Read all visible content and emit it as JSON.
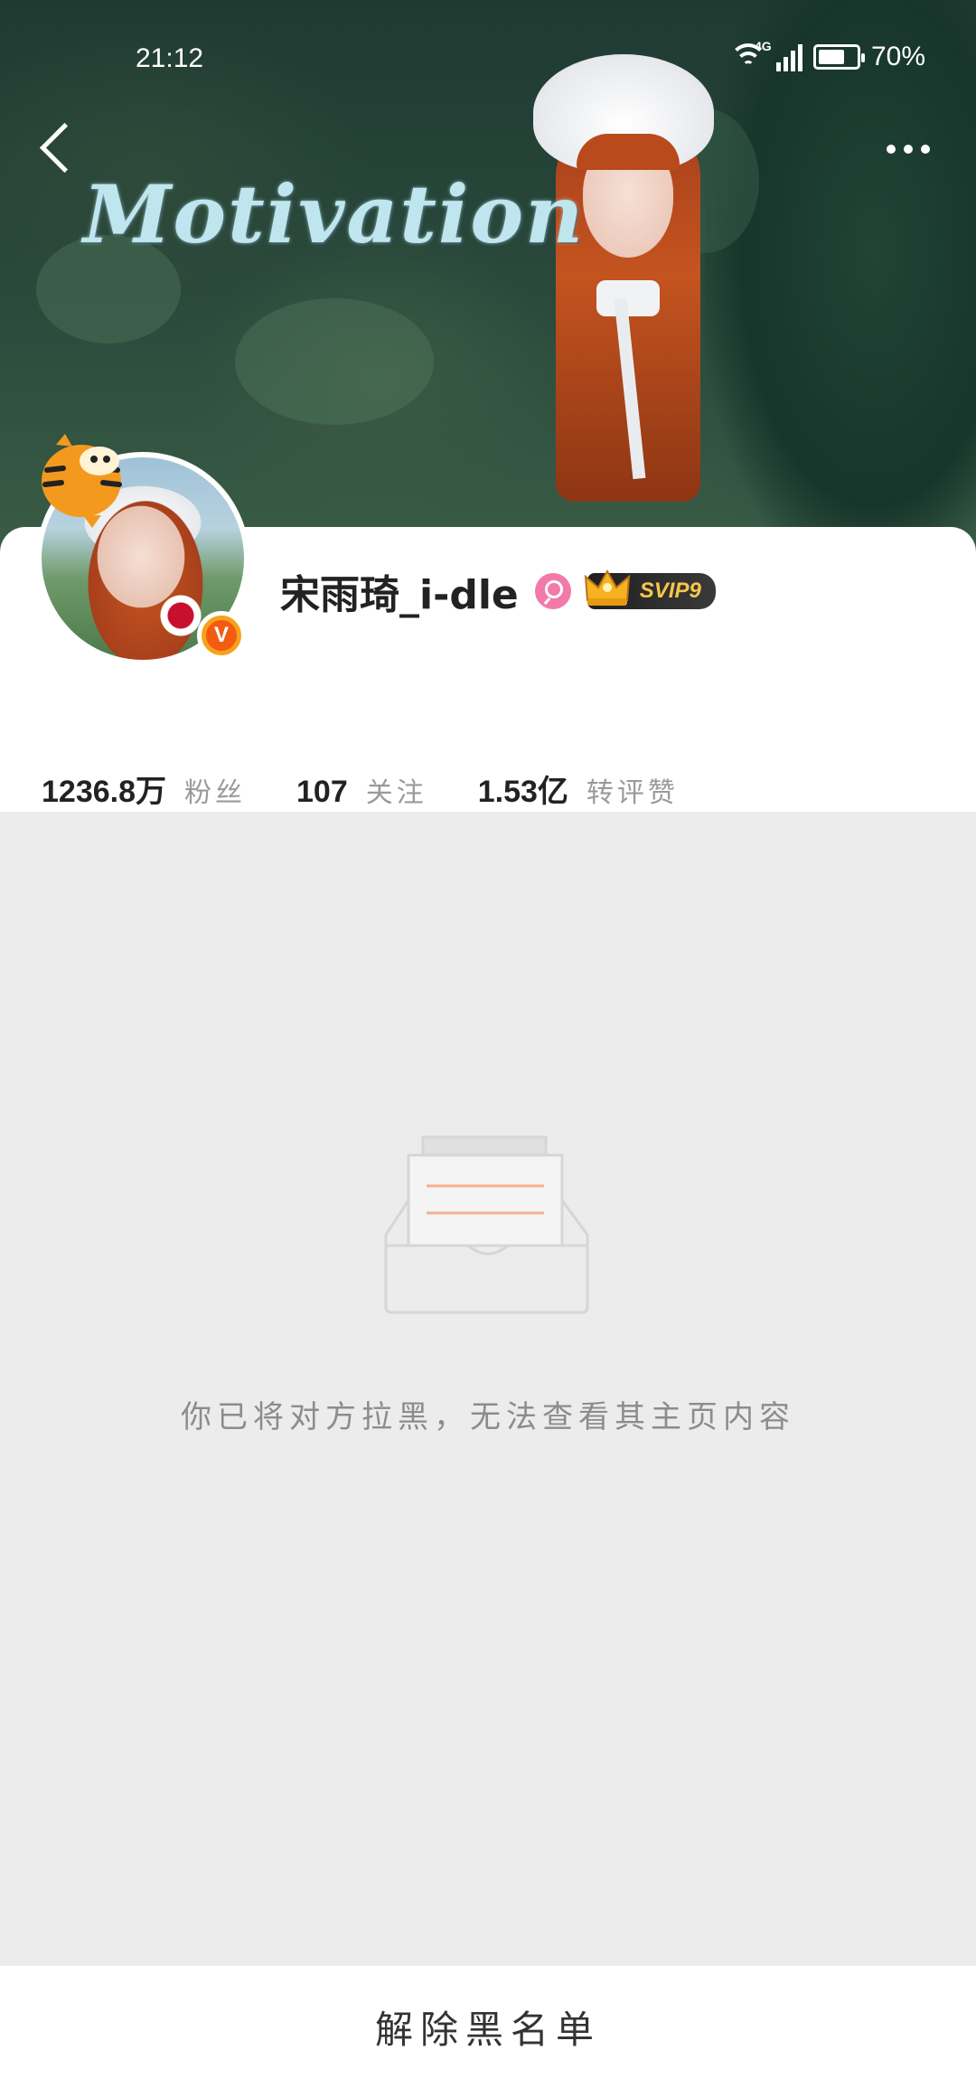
{
  "status_bar": {
    "time": "21:12",
    "network": "4G",
    "battery": "70%",
    "battery_level": 0.7
  },
  "header": {
    "banner_text": "Motivation",
    "back_icon": "chevron-left-icon",
    "more_icon": "more-dots-icon"
  },
  "profile": {
    "username": "宋雨琦_i-dle",
    "gender_icon": "female-icon",
    "vip_badge": "SVIP9",
    "verified_icon": "verified-v-icon",
    "stats": [
      {
        "value": "1236.8万",
        "label": "粉丝"
      },
      {
        "value": "107",
        "label": "关注"
      },
      {
        "value": "1.53亿",
        "label": "转评赞"
      }
    ]
  },
  "empty_state": {
    "icon": "empty-inbox-icon",
    "message": "你已将对方拉黑，无法查看其主页内容"
  },
  "bottom_bar": {
    "action_label": "解除黑名单"
  },
  "colors": {
    "accent_orange": "#f45a12",
    "vip_gold": "#f6c64a",
    "gender_pink": "#f27aa8",
    "background": "#ececec"
  }
}
